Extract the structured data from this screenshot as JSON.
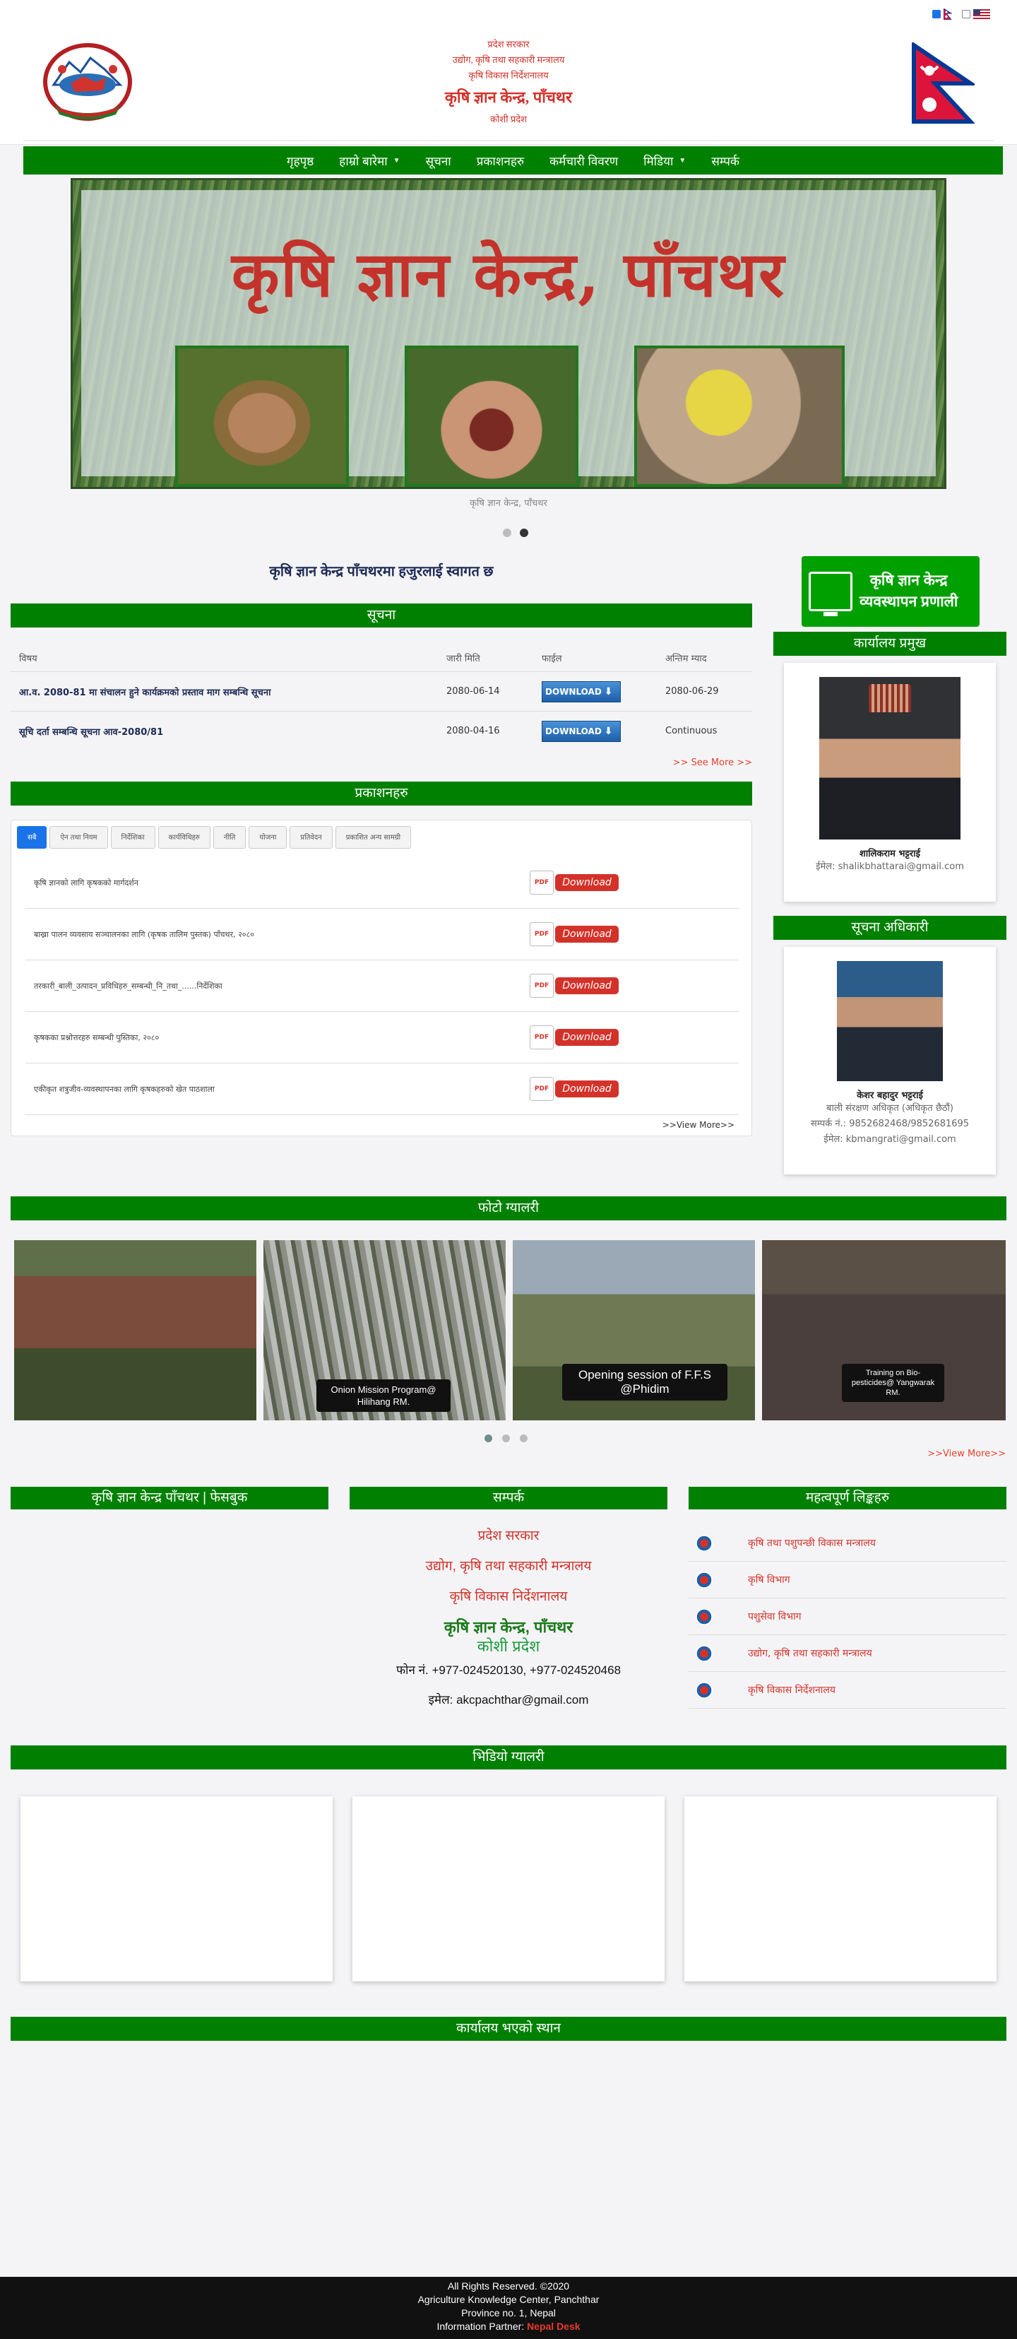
{
  "header": {
    "lang_options": [
      {
        "code": "ne",
        "checked": true
      },
      {
        "code": "en",
        "checked": false
      }
    ],
    "lines": [
      "प्रदेश सरकार",
      "उद्योग, कृषि तथा सहकारी मन्त्रालय",
      "कृषि विकास निर्देशनालय"
    ],
    "office": "कृषि ज्ञान केन्द्र, पाँचथर",
    "province": "कोशी प्रदेश"
  },
  "nav": {
    "items": [
      {
        "label": "गृहपृष्ठ",
        "dropdown": false
      },
      {
        "label": "हाम्रो बारेमा",
        "dropdown": true
      },
      {
        "label": "सूचना",
        "dropdown": false
      },
      {
        "label": "प्रकाशनहरु",
        "dropdown": false
      },
      {
        "label": "कर्मचारी विवरण",
        "dropdown": false
      },
      {
        "label": "मिडिया",
        "dropdown": true
      },
      {
        "label": "सम्पर्क",
        "dropdown": false
      }
    ]
  },
  "banner": {
    "title": "कृषि ज्ञान केन्द्र, पाँचथर",
    "caption": "कृषि ज्ञान केन्द्र, पाँचथर",
    "slide_index": 2,
    "slide_count": 2
  },
  "welcome": "कृषि ज्ञान केन्द्र पाँचथरमा हजुरलाई स्वागत छ",
  "notices": {
    "heading": "सूचना",
    "columns": [
      "विषय",
      "जारी मिति",
      "फाईल",
      "अन्तिम म्याद"
    ],
    "rows": [
      {
        "subject": "आ.व. 2080-81 मा संचालन हुने कार्यक्रमको प्रस्ताव माग सम्बन्धि सूचना",
        "date": "2080-06-14",
        "file": "DOWNLOAD",
        "deadline": "2080-06-29"
      },
      {
        "subject": "सूचि दर्ता सम्बन्धि सूचना आव-2080/81",
        "date": "2080-04-16",
        "file": "DOWNLOAD",
        "deadline": "Continuous"
      }
    ],
    "see_more": ">> See More >>"
  },
  "publications": {
    "heading": "प्रकाशनहरु",
    "tabs": [
      "सबै",
      "ऐन तथा नियम",
      "निर्देशिका",
      "कार्यविधिहरु",
      "नीति",
      "योजना",
      "प्रतिवेदन",
      "प्रकाशित अन्य सामग्री"
    ],
    "active_tab": 0,
    "items": [
      "कृषि ज्ञानको लागि कृषकको मार्गदर्शन",
      "बाख्रा पालन व्यवसाय सञ्चालनका लागि (कृषक तालिम पुस्तक) पाँचथर, २०८०",
      "तरकारी_बाली_उत्पादन_प्रविधिहरु_सम्बन्धी_नि_तथा_......निर्देशिका",
      "कृषकका प्रश्नोत्तरहरु सम्बन्धी पुस्तिका, २०८०",
      "एकीकृत शत्रुजीव-व्यवस्थापनका लागि कृषकहरुको खेत पाठशाला"
    ],
    "download_label": "Download",
    "pdf_label": "PDF",
    "view_more": ">>View More>>"
  },
  "sidebar": {
    "akc_button": {
      "line1": "कृषि ज्ञान केन्द्र",
      "line2": "व्यवस्थापन प्रणाली"
    },
    "chief": {
      "heading": "कार्यालय प्रमुख",
      "name": "शालिकराम भट्टराई",
      "email_label": "ईमेल:",
      "email": "shalikbhattarai@gmail.com"
    },
    "info_officer": {
      "heading": "सूचना अधिकारी",
      "name": "केशर बहादुर भट्टराई",
      "post": "बाली संरक्षण अधिकृत (अधिकृत छैठौं)",
      "phone_label": "सम्पर्क नं.:",
      "phone": "9852682468/9852681695",
      "email_label": "ईमेल:",
      "email": "kbmangrati@gmail.com"
    }
  },
  "photo_gallery": {
    "heading": "फोटो ग्यालरी",
    "captions": [
      "",
      "Onion Mission Program@ Hilihang RM.",
      "Opening session of F.F.S @Phidim",
      "Training on Bio-pesticides@ Yangwarak RM."
    ],
    "dots": 3,
    "active_dot": 0,
    "view_more": ">>View More>>"
  },
  "facebook": {
    "heading": "कृषि ज्ञान केन्द्र पाँचथर | फेसबुक"
  },
  "contact": {
    "heading": "सम्पर्क",
    "line1": "प्रदेश सरकार",
    "line2": "उद्योग, कृषि तथा सहकारी मन्त्रालय",
    "line3": "कृषि विकास निर्देशनालय",
    "office": "कृषि ज्ञान केन्द्र, पाँचथर",
    "province": "कोशी प्रदेश",
    "phone": "फोन नं. +977-024520130, +977-024520468",
    "email": "इमेल: akcpachthar@gmail.com"
  },
  "links": {
    "heading": "महत्वपूर्ण लिङ्कहरु",
    "items": [
      "कृषि तथा पशुपन्छी विकास मन्त्रालय",
      "कृषि विभाग",
      "पशुसेवा विभाग",
      "उद्योग, कृषि तथा सहकारी मन्त्रालय",
      "कृषि विकास निर्देशनालय"
    ]
  },
  "video_gallery": {
    "heading": "भिडियो ग्यालरी"
  },
  "location": {
    "heading": "कार्यालय भएको स्थान"
  },
  "footer": {
    "rights": "All Rights Reserved. ©2020",
    "center": "Agriculture Knowledge Center, Panchthar",
    "province": "Province no. 1, Nepal",
    "partner_label": "Information Partner:",
    "partner_name": "Nepal Desk"
  },
  "colors": {
    "primary_green": "#008000",
    "accent_red": "#d3322a",
    "footer_bg": "#111111"
  }
}
